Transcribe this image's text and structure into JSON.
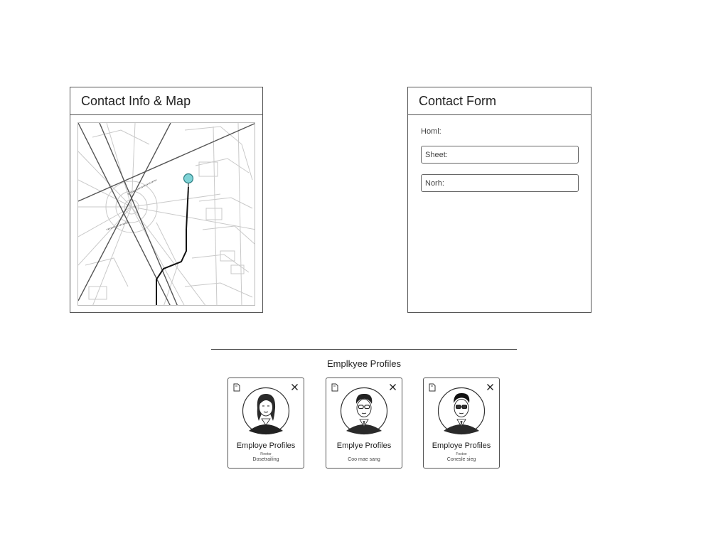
{
  "map_panel": {
    "title": "Contact Info & Map",
    "pin_color": "#7fd3d6",
    "route_color": "#111111"
  },
  "form_panel": {
    "title": "Contact Form",
    "label": "Homl:",
    "street_placeholder": "Sheet:",
    "north_placeholder": "Norh:"
  },
  "profiles": {
    "title": "Emplkyee Profiles",
    "cards": [
      {
        "name": "Employe Profiles",
        "role": "Finetor",
        "detail": "Dosetrailing",
        "avatar": "female-avatar-icon"
      },
      {
        "name": "Emplye Profiles",
        "role": "",
        "detail": "Coo mae sang",
        "avatar": "male-glasses-avatar-icon"
      },
      {
        "name": "Employe Profiles",
        "role": "Fostoe",
        "detail": "Conesle sieg",
        "avatar": "male-dark-glasses-avatar-icon"
      }
    ]
  }
}
